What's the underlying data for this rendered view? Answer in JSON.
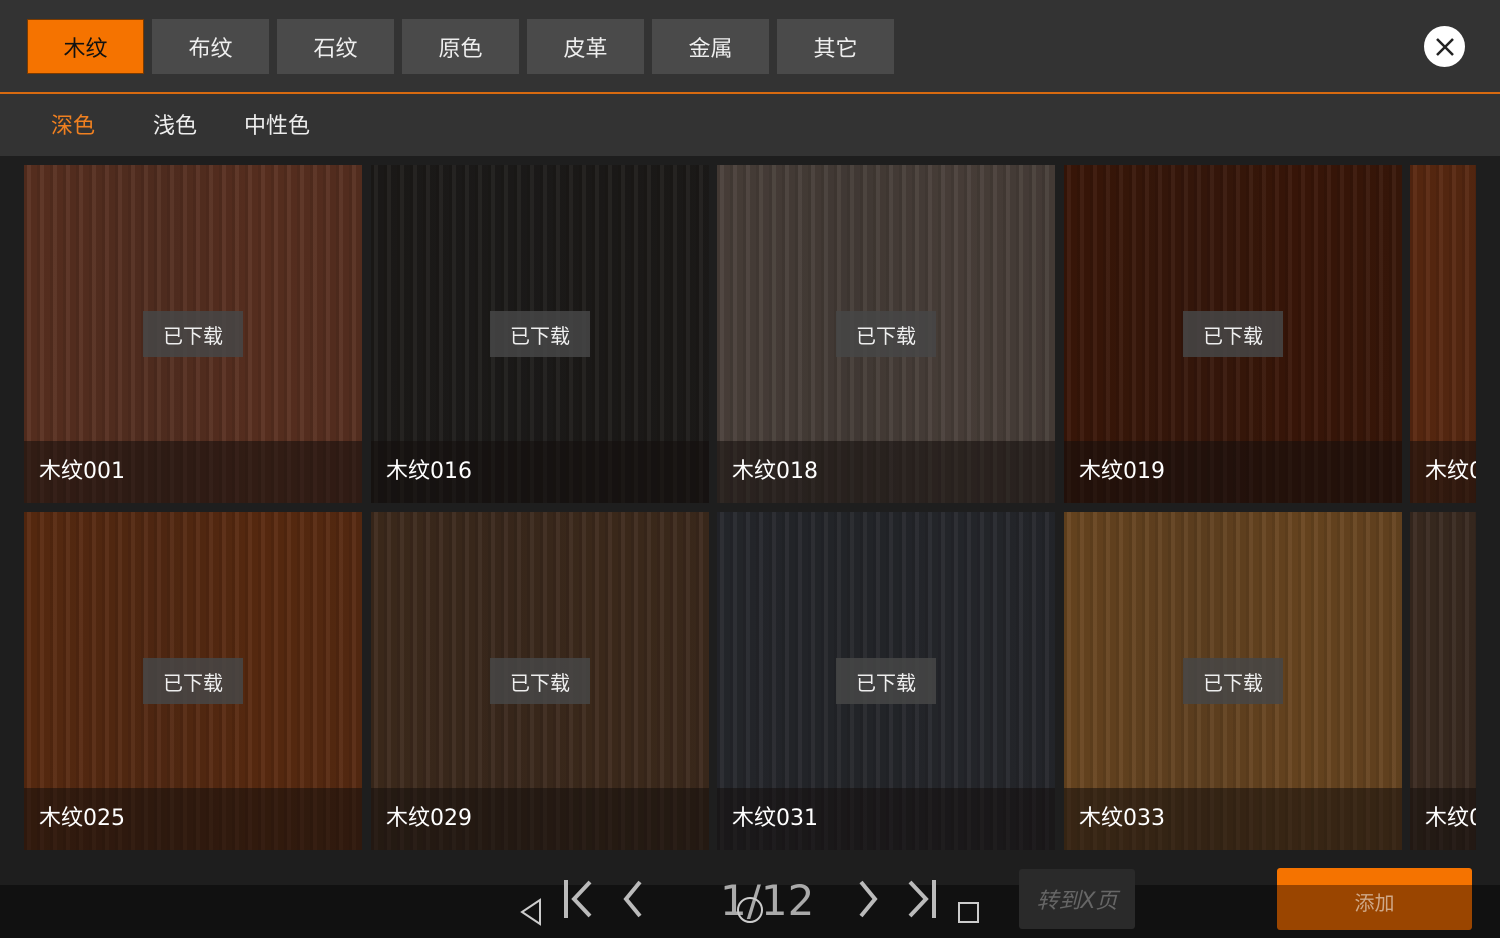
{
  "tabs": [
    {
      "label": "木纹",
      "active": true
    },
    {
      "label": "布纹"
    },
    {
      "label": "石纹"
    },
    {
      "label": "原色"
    },
    {
      "label": "皮革"
    },
    {
      "label": "金属"
    },
    {
      "label": "其它"
    }
  ],
  "subtabs": [
    {
      "label": "深色",
      "active": true
    },
    {
      "label": "浅色"
    },
    {
      "label": "中性色"
    }
  ],
  "colors": {
    "accent": "#f57300",
    "panel": "#333333",
    "background": "#1e1e1e"
  },
  "badge": "已下载",
  "items": [
    {
      "name": "木纹001",
      "color": "#5a3020"
    },
    {
      "name": "木纹016",
      "color": "#1c1a18"
    },
    {
      "name": "木纹018",
      "color": "#4a403a"
    },
    {
      "name": "木纹019",
      "color": "#3a1608"
    },
    {
      "name": "木纹0",
      "color": "#5a2810"
    },
    {
      "name": "木纹025",
      "color": "#5a2a10"
    },
    {
      "name": "木纹029",
      "color": "#3e2a1c"
    },
    {
      "name": "木纹031",
      "color": "#25272c"
    },
    {
      "name": "木纹033",
      "color": "#6a4620"
    },
    {
      "name": "木纹0",
      "color": "#3a2a20"
    }
  ],
  "pagination": {
    "current": "1",
    "total": "12",
    "separator": "/",
    "goto_placeholder": "转到X页"
  },
  "add_label": "添加"
}
